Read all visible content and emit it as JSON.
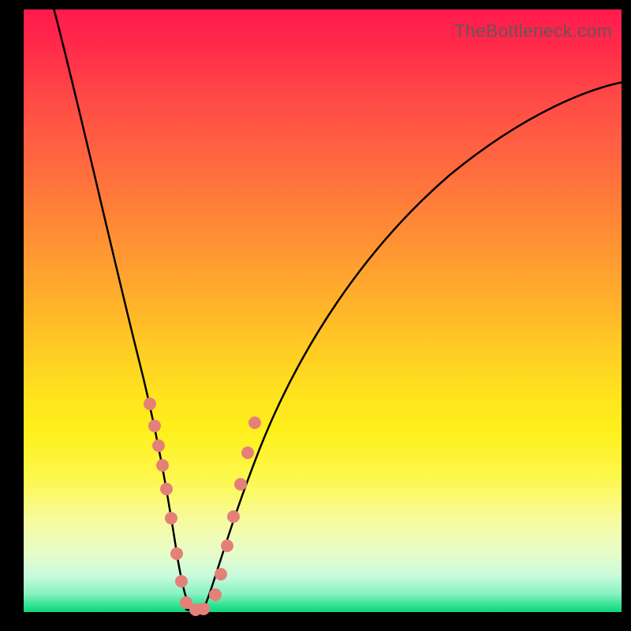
{
  "watermark": "TheBottleneck.com",
  "chart_data": {
    "type": "line",
    "title": "",
    "xlabel": "",
    "ylabel": "",
    "xlim": [
      0,
      100
    ],
    "ylim": [
      0,
      100
    ],
    "background_gradient": {
      "top": "#ff1a4d",
      "middle": "#ffe31e",
      "bottom": "#0fd47d"
    },
    "series": [
      {
        "name": "bottleneck-curve",
        "x": [
          5,
          10,
          15,
          18,
          20,
          22,
          24,
          25,
          26,
          27,
          28,
          30,
          32,
          34,
          38,
          44,
          52,
          62,
          75,
          88,
          100
        ],
        "y": [
          100,
          78,
          56,
          45,
          37,
          30,
          20,
          12,
          4,
          0,
          0,
          0,
          4,
          12,
          24,
          38,
          52,
          64,
          74,
          80,
          85
        ]
      }
    ],
    "markers": {
      "name": "highlight-dots",
      "color": "#e58079",
      "x": [
        20.6,
        21.5,
        22.1,
        22.7,
        23.4,
        24.2,
        25.2,
        26.0,
        26.8,
        28.6,
        29.8,
        31.8,
        32.6,
        33.6,
        34.6,
        35.8,
        37.0,
        38.2
      ],
      "y": [
        34,
        30,
        27,
        24,
        20,
        15,
        9,
        4,
        1,
        0,
        0,
        2,
        6,
        11,
        16,
        22,
        27,
        32
      ]
    },
    "curve_minimum_x": 27.5
  }
}
